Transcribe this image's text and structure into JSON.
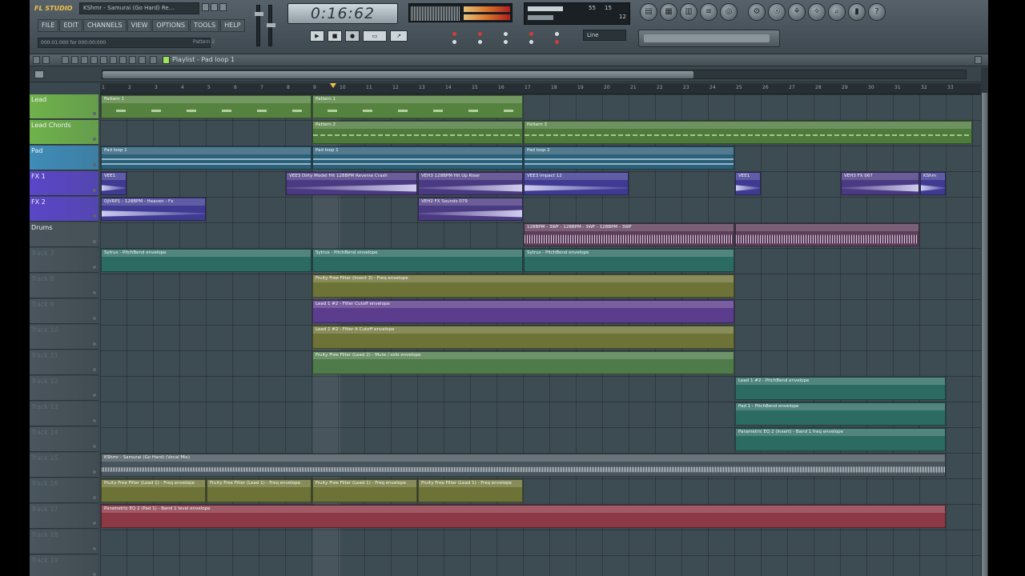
{
  "app": {
    "logo": "FL STUDIO",
    "window_title": "KShmr - Samurai (Go Hard) Re..."
  },
  "menu": [
    "FILE",
    "EDIT",
    "CHANNELS",
    "VIEW",
    "OPTIONS",
    "TOOLS",
    "HELP"
  ],
  "hint_bar": {
    "text": "000:01:000 for 000:00:000",
    "pattern": "Pattern 2"
  },
  "transport": {
    "time": "0:16:62",
    "play_icon": "play-icon",
    "stop_icon": "stop-icon",
    "record_icon": "record-icon"
  },
  "monitor": {
    "cpu": "55",
    "mem": "15",
    "poly": "12"
  },
  "recording": {
    "input": "Line"
  },
  "playlist": {
    "title": "Playlist - Pad loop 1"
  },
  "ruler": [
    "1",
    "2",
    "3",
    "4",
    "5",
    "6",
    "7",
    "8",
    "9",
    "10",
    "11",
    "12",
    "13",
    "14",
    "15",
    "16",
    "17",
    "18",
    "19",
    "20",
    "21",
    "22",
    "23",
    "24",
    "25",
    "26",
    "27",
    "28",
    "29",
    "30",
    "31",
    "32",
    "33"
  ],
  "tracks": [
    {
      "name": "Lead",
      "color": "#6fb24b",
      "active": true
    },
    {
      "name": "Lead Chords",
      "color": "#6fb24b",
      "active": true
    },
    {
      "name": "Pad",
      "color": "#3e8cb8",
      "active": true
    },
    {
      "name": "FX 1",
      "color": "#5a46c8",
      "active": true
    },
    {
      "name": "FX 2",
      "color": "#5a46c8",
      "active": true
    },
    {
      "name": "Drums",
      "color": "#48535a",
      "active": true
    },
    {
      "name": "Track 7",
      "active": false
    },
    {
      "name": "Track 8",
      "active": false
    },
    {
      "name": "Track 9",
      "active": false
    },
    {
      "name": "Track 10",
      "active": false
    },
    {
      "name": "Track 11",
      "active": false
    },
    {
      "name": "Track 12",
      "active": false
    },
    {
      "name": "Track 13",
      "active": false
    },
    {
      "name": "Track 14",
      "active": false
    },
    {
      "name": "Track 15",
      "active": false
    },
    {
      "name": "Track 16",
      "active": false
    },
    {
      "name": "Track 17",
      "active": false
    },
    {
      "name": "Track 18",
      "active": false
    },
    {
      "name": "Track 19",
      "active": false
    }
  ],
  "clips": [
    {
      "track": 0,
      "start": 0,
      "len": 8,
      "kind": "c-lead",
      "label": "Pattern 1"
    },
    {
      "track": 0,
      "start": 8,
      "len": 8,
      "kind": "c-lead",
      "label": "Pattern 1"
    },
    {
      "track": 1,
      "start": 8,
      "len": 8,
      "kind": "c-chords",
      "label": "Pattern 2"
    },
    {
      "track": 1,
      "start": 16,
      "len": 17,
      "kind": "c-chords",
      "label": "Pattern 3"
    },
    {
      "track": 2,
      "start": 0,
      "len": 8,
      "kind": "c-pad",
      "label": "Pad loop 1"
    },
    {
      "track": 2,
      "start": 8,
      "len": 8,
      "kind": "c-pad",
      "label": "Pad loop 1"
    },
    {
      "track": 2,
      "start": 16,
      "len": 8,
      "kind": "c-pad",
      "label": "Pad loop 2"
    },
    {
      "track": 3,
      "start": 0,
      "len": 1,
      "kind": "c-fx",
      "label": "VEE1"
    },
    {
      "track": 3,
      "start": 7,
      "len": 5,
      "kind": "c-fx2",
      "label": "VEE3 Dirty Model Hit 128BPM Reverse Crash"
    },
    {
      "track": 3,
      "start": 12,
      "len": 4,
      "kind": "c-fx2",
      "label": "VEH3 128BPM Hit Up Riser"
    },
    {
      "track": 3,
      "start": 16,
      "len": 4,
      "kind": "c-fx",
      "label": "VEE3 Impact 12"
    },
    {
      "track": 3,
      "start": 24,
      "len": 1,
      "kind": "c-fx",
      "label": "VEE1"
    },
    {
      "track": 3,
      "start": 28,
      "len": 3,
      "kind": "c-fx2",
      "label": "VEH3 FX 067"
    },
    {
      "track": 3,
      "start": 31,
      "len": 1,
      "kind": "c-fx",
      "label": "KShm"
    },
    {
      "track": 4,
      "start": 0,
      "len": 4,
      "kind": "c-fx",
      "label": "DJVRP1 - 128BPM - Heaven - Fx"
    },
    {
      "track": 4,
      "start": 12,
      "len": 4,
      "kind": "c-fx2",
      "label": "VEH2 FX Sounds 079"
    },
    {
      "track": 5,
      "start": 16,
      "len": 8,
      "kind": "c-drum",
      "label": "128BPM - 3WF - 128BPM - 3WF - 128BPM - 3WF"
    },
    {
      "track": 5,
      "start": 24,
      "len": 7,
      "kind": "c-drum",
      "label": ""
    },
    {
      "track": 6,
      "start": 0,
      "len": 8,
      "kind": "c-auto",
      "label": "Sytrus - PitchBend envelope"
    },
    {
      "track": 6,
      "start": 8,
      "len": 8,
      "kind": "c-auto",
      "label": "Sytrus - PitchBend envelope"
    },
    {
      "track": 6,
      "start": 16,
      "len": 8,
      "kind": "c-auto",
      "label": "Sytrus - PitchBend envelope"
    },
    {
      "track": 7,
      "start": 8,
      "len": 16,
      "kind": "c-yellow",
      "label": "Fruity Free Filter (Insert 3) - Freq envelope"
    },
    {
      "track": 8,
      "start": 8,
      "len": 16,
      "kind": "c-purple",
      "label": "Lead 1 #2 - Filter Cutoff envelope"
    },
    {
      "track": 9,
      "start": 8,
      "len": 16,
      "kind": "c-yellow",
      "label": "Lead 1 #2 - Filter A Cutoff envelope"
    },
    {
      "track": 10,
      "start": 8,
      "len": 16,
      "kind": "c-green2",
      "label": "Fruity Free Filter (Lead 2) - Mute / solo envelope"
    },
    {
      "track": 11,
      "start": 24,
      "len": 8,
      "kind": "c-auto",
      "label": "Lead 1 #2 - PitchBend envelope"
    },
    {
      "track": 12,
      "start": 24,
      "len": 8,
      "kind": "c-auto",
      "label": "Pad 1 - PitchBend envelope"
    },
    {
      "track": 13,
      "start": 24,
      "len": 8,
      "kind": "c-auto",
      "label": "Parametric EQ 2 (Insert) - Band 1 freq envelope"
    },
    {
      "track": 14,
      "start": 0,
      "len": 32,
      "kind": "c-audio",
      "label": "KShmr - Samurai (Go Hard) (Vocal Mix)"
    },
    {
      "track": 15,
      "start": 0,
      "len": 4,
      "kind": "c-yellow",
      "label": "Fruity Free Filter (Lead 1) - Freq envelope"
    },
    {
      "track": 15,
      "start": 4,
      "len": 4,
      "kind": "c-yellow",
      "label": "Fruity Free Filter (Lead 1) - Freq envelope"
    },
    {
      "track": 15,
      "start": 8,
      "len": 4,
      "kind": "c-yellow",
      "label": "Fruity Free Filter (Lead 1) - Freq envelope"
    },
    {
      "track": 15,
      "start": 12,
      "len": 4,
      "kind": "c-yellow",
      "label": "Fruity Free Filter (Lead 1) - Freq envelope"
    },
    {
      "track": 16,
      "start": 0,
      "len": 32,
      "kind": "c-red",
      "label": "Parametric EQ 2 (Pad 1) - Band 1 level envelope"
    }
  ]
}
